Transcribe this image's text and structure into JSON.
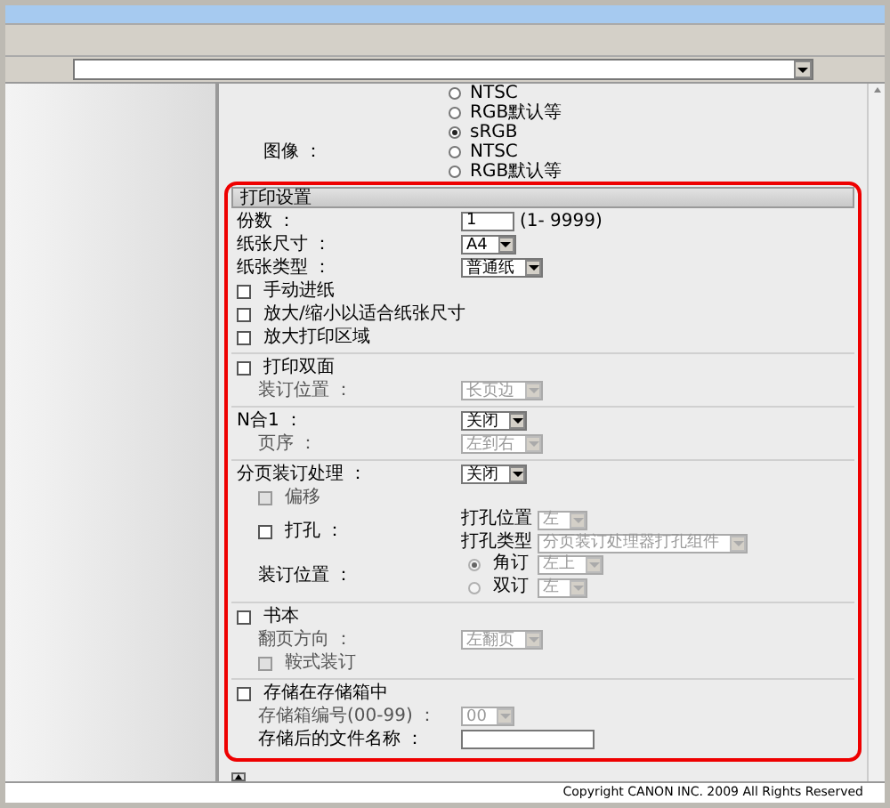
{
  "image_section": {
    "radios_above": [
      {
        "label": "NTSC",
        "selected": false
      },
      {
        "label": "RGB默认等",
        "selected": false
      }
    ],
    "label": "图像 ：",
    "radios": [
      {
        "label": "sRGB",
        "selected": true
      },
      {
        "label": "NTSC",
        "selected": false
      },
      {
        "label": "RGB默认等",
        "selected": false
      }
    ]
  },
  "print_settings": {
    "title": "打印设置",
    "groups": [
      {
        "rows": [
          {
            "kind": "input",
            "label": "份数 ：",
            "value": "1",
            "hint": "(1- 9999)"
          },
          {
            "kind": "select",
            "label": "纸张尺寸 ：",
            "value": "A4",
            "disabled": false
          },
          {
            "kind": "select",
            "label": "纸张类型 ：",
            "value": "普通纸",
            "disabled": false
          },
          {
            "kind": "checkbox",
            "label": "手动进纸",
            "checked": false,
            "disabled": false
          },
          {
            "kind": "checkbox",
            "label": "放大/缩小以适合纸张尺寸",
            "checked": false,
            "disabled": false
          },
          {
            "kind": "checkbox",
            "label": "放大打印区域",
            "checked": false,
            "disabled": false
          }
        ]
      },
      {
        "rows": [
          {
            "kind": "checkbox",
            "label": "打印双面",
            "checked": false,
            "disabled": false,
            "children": [
              {
                "kind": "select",
                "label": "装订位置 ：",
                "value": "长页边",
                "disabled": true
              }
            ]
          }
        ]
      },
      {
        "rows": [
          {
            "kind": "select",
            "label": "N合1 ：",
            "value": "关闭",
            "disabled": false,
            "children": [
              {
                "kind": "select",
                "label": "页序 ：",
                "value": "左到右",
                "disabled": true
              }
            ]
          }
        ]
      },
      {
        "rows": [
          {
            "kind": "select",
            "label": "分页装订处理 ：",
            "value": "关闭",
            "disabled": false,
            "children": [
              {
                "kind": "checkbox",
                "label": "偏移",
                "checked": false,
                "disabled": true
              },
              {
                "kind": "punch",
                "label": "打孔 ：",
                "checked": false,
                "disabled": false,
                "fields": [
                  {
                    "label": "打孔位置",
                    "value": "左",
                    "disabled": true
                  },
                  {
                    "label": "打孔类型",
                    "value": "分页装订处理器打孔组件",
                    "disabled": true
                  }
                ]
              },
              {
                "kind": "radio-select",
                "label": "装订位置 ：",
                "options": [
                  {
                    "label": "角订",
                    "selected": true,
                    "value": "左上",
                    "disabled": true
                  },
                  {
                    "label": "双订",
                    "selected": false,
                    "value": "左",
                    "disabled": true
                  }
                ]
              }
            ]
          }
        ]
      },
      {
        "rows": [
          {
            "kind": "checkbox",
            "label": "书本",
            "checked": false,
            "disabled": false,
            "children": [
              {
                "kind": "select",
                "label": "翻页方向 ：",
                "value": "左翻页",
                "disabled": true
              },
              {
                "kind": "checkbox",
                "label": "鞍式装订",
                "checked": false,
                "disabled": true
              }
            ]
          }
        ]
      },
      {
        "rows": [
          {
            "kind": "checkbox",
            "label": "存储在存储箱中",
            "checked": false,
            "disabled": false,
            "children": [
              {
                "kind": "select",
                "label": "存储箱编号(00-99) ：",
                "value": "00",
                "disabled": true
              },
              {
                "kind": "input",
                "label": "存储后的文件名称 ："
              }
            ]
          }
        ]
      }
    ]
  },
  "footer": {
    "copyright": "Copyright CANON INC. 2009 All Rights Reserved"
  }
}
